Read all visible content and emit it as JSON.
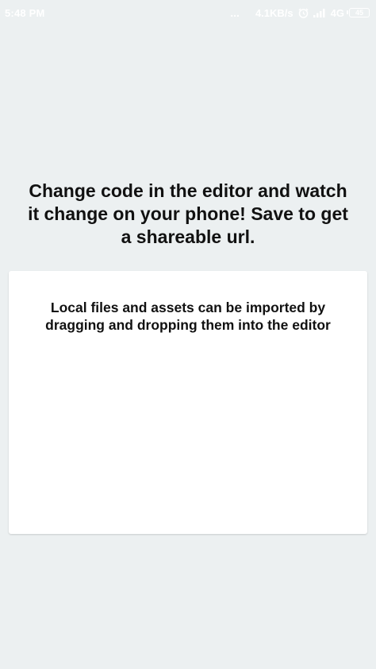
{
  "status_bar": {
    "time": "5:48 PM",
    "dots": "...",
    "network_speed": "4.1KB/s",
    "network_type": "4G",
    "battery_level": "45"
  },
  "main": {
    "headline": "Change code in the editor and watch it change on your phone! Save to get a shareable url.",
    "card_text": "Local files and assets can be imported by dragging and dropping them into the editor"
  },
  "colors": {
    "background": "#ecf0f1",
    "card": "#ffffff",
    "text": "#111111"
  }
}
